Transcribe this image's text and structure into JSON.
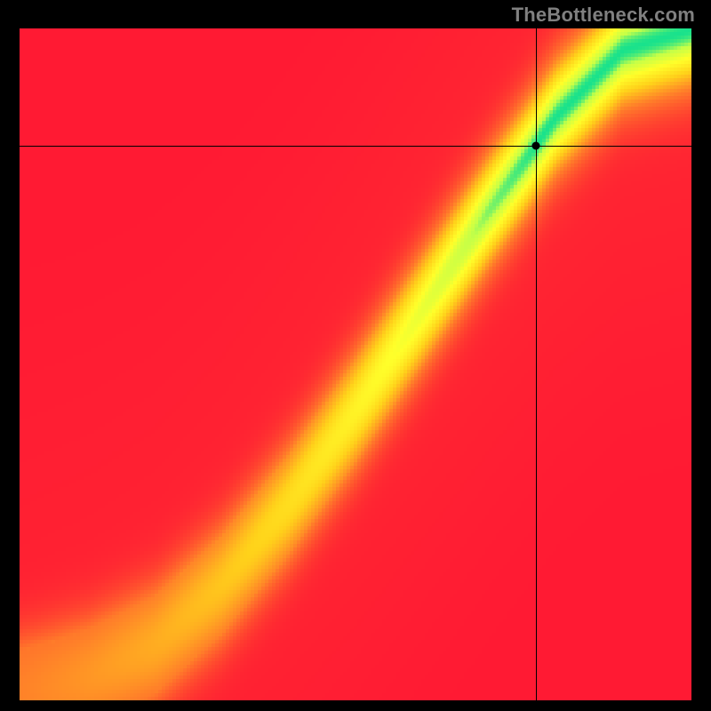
{
  "attribution": "TheBottleneck.com",
  "chart_data": {
    "type": "heatmap",
    "title": "",
    "xlabel": "",
    "ylabel": "",
    "xlim": [
      0,
      1
    ],
    "ylim": [
      0,
      1
    ],
    "crosshair": {
      "x": 0.768,
      "y": 0.826
    },
    "marker": {
      "x": 0.768,
      "y": 0.826
    },
    "ridge_curve": [
      {
        "x": 0.0,
        "y": 0.0
      },
      {
        "x": 0.1,
        "y": 0.03
      },
      {
        "x": 0.2,
        "y": 0.08
      },
      {
        "x": 0.3,
        "y": 0.17
      },
      {
        "x": 0.4,
        "y": 0.29
      },
      {
        "x": 0.5,
        "y": 0.43
      },
      {
        "x": 0.6,
        "y": 0.58
      },
      {
        "x": 0.7,
        "y": 0.73
      },
      {
        "x": 0.8,
        "y": 0.87
      },
      {
        "x": 0.9,
        "y": 0.97
      },
      {
        "x": 1.0,
        "y": 1.0
      }
    ],
    "ridge_width": 0.06,
    "colorscale": [
      {
        "t": 0.0,
        "color": "#ff1a33"
      },
      {
        "t": 0.35,
        "color": "#ff7a2a"
      },
      {
        "t": 0.6,
        "color": "#ffd21a"
      },
      {
        "t": 0.8,
        "color": "#ffff2a"
      },
      {
        "t": 0.93,
        "color": "#c6ff47"
      },
      {
        "t": 1.0,
        "color": "#19e28c"
      }
    ]
  }
}
